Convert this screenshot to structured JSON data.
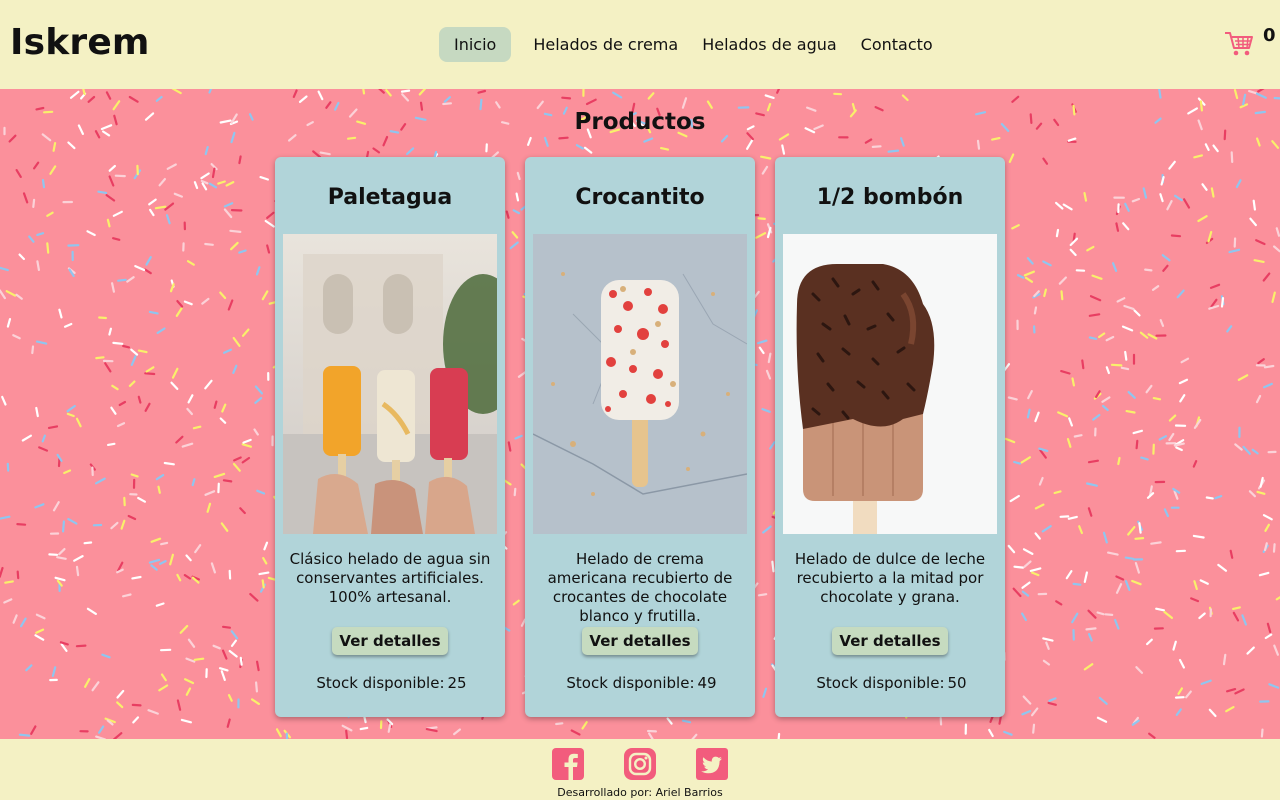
{
  "header": {
    "brand": "Iskrem",
    "nav": [
      {
        "label": "Inicio",
        "active": true
      },
      {
        "label": "Helados de crema",
        "active": false
      },
      {
        "label": "Helados de agua",
        "active": false
      },
      {
        "label": "Contacto",
        "active": false
      }
    ],
    "cart_icon": "shopping-cart-icon",
    "cart_count": "0"
  },
  "main": {
    "title": "Productos",
    "products": [
      {
        "name": "Paletagua",
        "description": "Clásico helado de agua sin conservantes artificiales. 100% artesanal.",
        "button": "Ver detalles",
        "stock_label": "Stock disponible:",
        "stock": "25"
      },
      {
        "name": "Crocantito",
        "description": "Helado de crema americana recubierto de crocantes de chocolate blanco y frutilla.",
        "button": "Ver detalles",
        "stock_label": "Stock disponible:",
        "stock": "49"
      },
      {
        "name": "1/2 bombón",
        "description": "Helado de dulce de leche recubierto a la mitad por chocolate y grana.",
        "button": "Ver detalles",
        "stock_label": "Stock disponible:",
        "stock": "50"
      }
    ]
  },
  "footer": {
    "socials": [
      "facebook-icon",
      "instagram-icon",
      "twitter-icon"
    ],
    "credit": "Desarrollado por: Ariel Barrios"
  },
  "colors": {
    "header_bg": "#f4f1c4",
    "main_bg": "#fb909b",
    "card_bg": "#b1d4d9",
    "button_bg": "#c6dbc0",
    "accent_pink": "#f25c7d"
  }
}
